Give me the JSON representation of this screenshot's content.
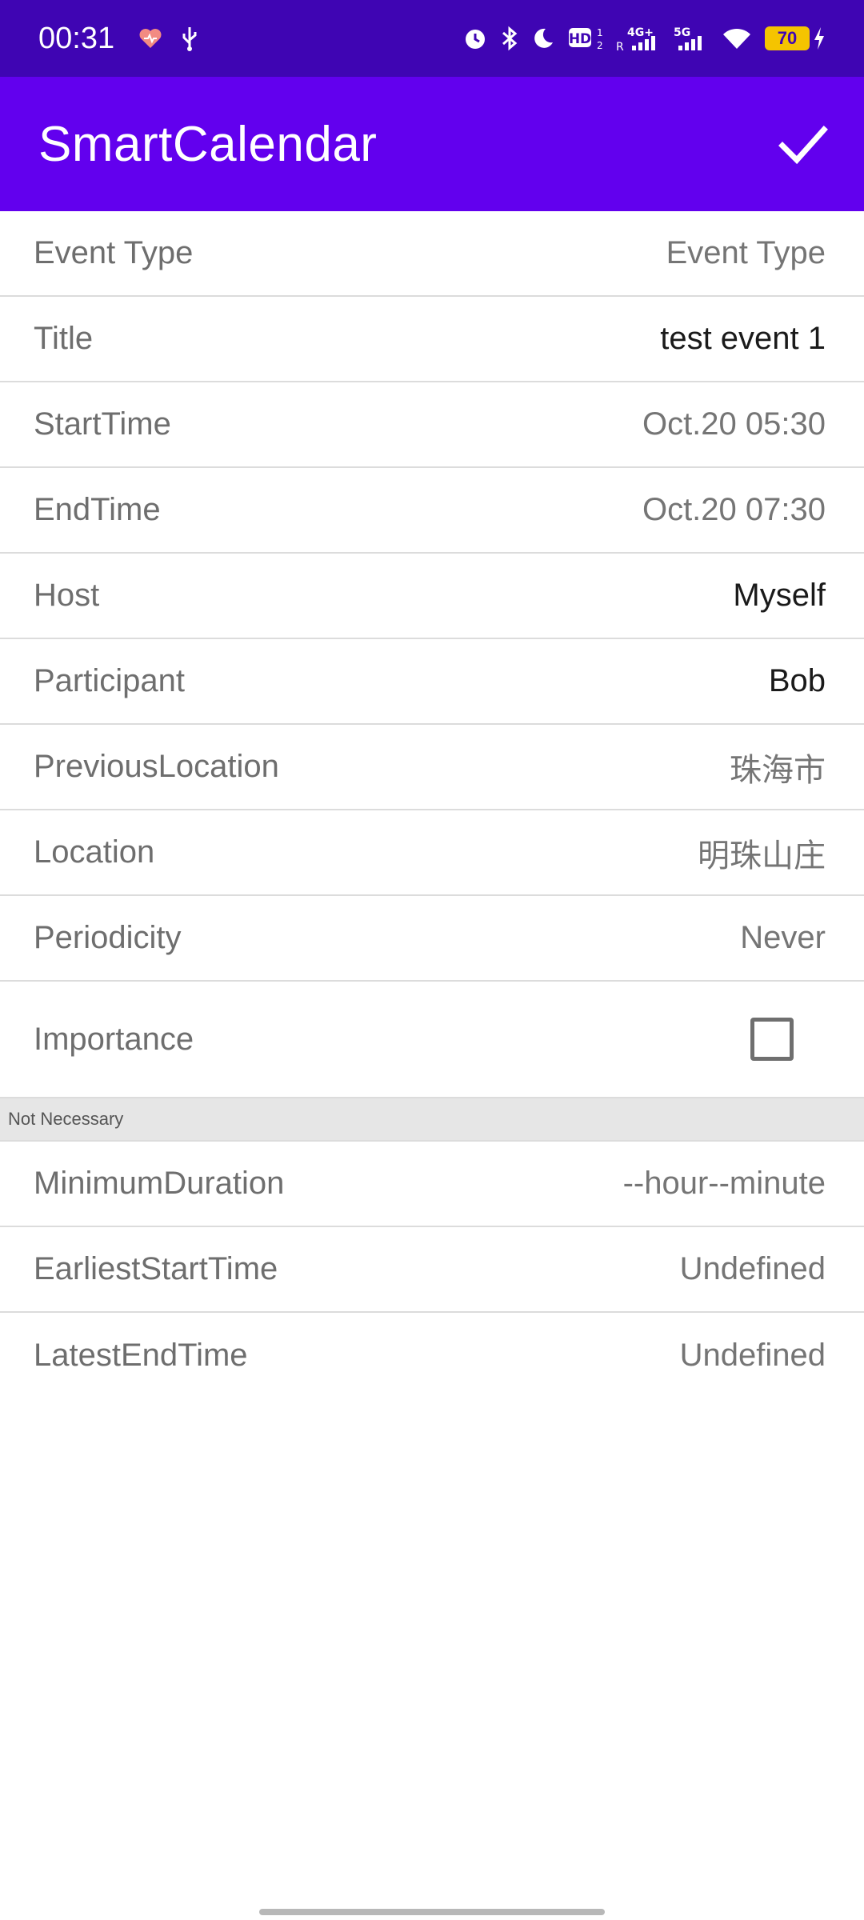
{
  "status_bar": {
    "time": "00:31",
    "network_1": "4G+",
    "network_2": "5G",
    "battery_level": "70",
    "icons": [
      "heart-icon",
      "usb-icon",
      "alarm-icon",
      "bluetooth-icon",
      "moon-icon",
      "hd-icon",
      "signal-icon",
      "wifi-icon",
      "battery-icon",
      "charging-icon"
    ]
  },
  "app_bar": {
    "title": "SmartCalendar",
    "confirm_icon": "check-icon"
  },
  "form": {
    "fields": [
      {
        "label": "Event Type",
        "value": "Event Type"
      },
      {
        "label": "Title",
        "value": "test event 1"
      },
      {
        "label": "StartTime",
        "value": "Oct.20 05:30"
      },
      {
        "label": "EndTime",
        "value": "Oct.20 07:30"
      },
      {
        "label": "Host",
        "value": "Myself"
      },
      {
        "label": "Participant",
        "value": "Bob"
      },
      {
        "label": "PreviousLocation",
        "value": "珠海市"
      },
      {
        "label": "Location",
        "value": "明珠山庄"
      },
      {
        "label": "Periodicity",
        "value": "Never"
      }
    ],
    "importance": {
      "label": "Importance",
      "checked": false
    },
    "optional_section": {
      "header": "Not Necessary",
      "fields": [
        {
          "label": "MinimumDuration",
          "value": "--hour--minute"
        },
        {
          "label": "EarliestStartTime",
          "value": "Undefined"
        },
        {
          "label": "LatestEndTime",
          "value": "Undefined"
        }
      ]
    }
  },
  "colors": {
    "status_bar": "#3f05b3",
    "app_bar": "#6200ee",
    "battery": "#f5c400"
  }
}
